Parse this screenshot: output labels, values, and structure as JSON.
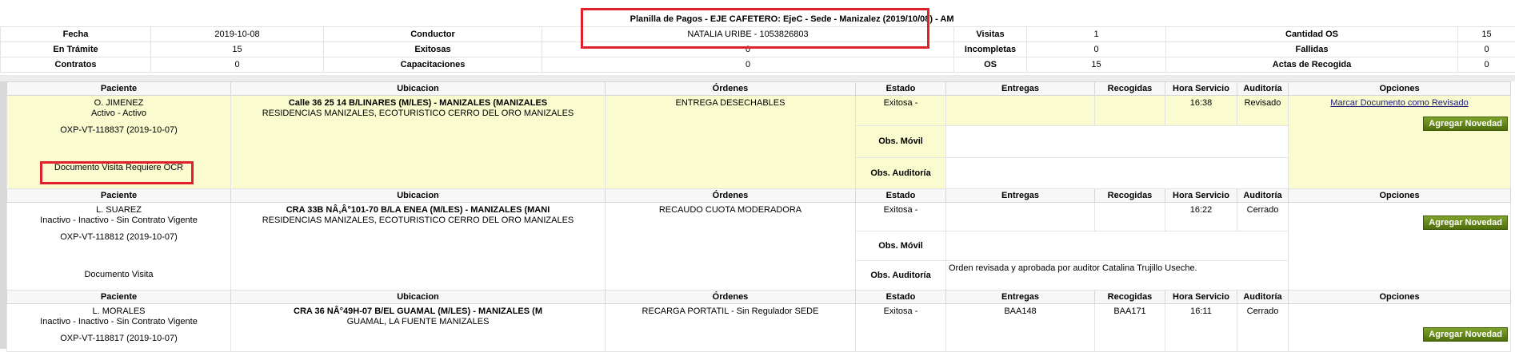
{
  "title": "Planilla de Pagos - EJE CAFETERO: EjeC - Sede - Manizalez (2019/10/08) - AM",
  "summary": {
    "row1": [
      {
        "label": "Fecha",
        "value": "2019-10-08"
      },
      {
        "label": "Conductor",
        "value": "NATALIA URIBE - 1053826803"
      },
      {
        "label": "Visitas",
        "value": "1"
      },
      {
        "label": "Cantidad OS",
        "value": "15"
      }
    ],
    "row2": [
      {
        "label": "En Trámite",
        "value": "15"
      },
      {
        "label": "Exitosas",
        "value": "0"
      },
      {
        "label": "Incompletas",
        "value": "0"
      },
      {
        "label": "Fallidas",
        "value": "0"
      }
    ],
    "row3": [
      {
        "label": "Contratos",
        "value": "0"
      },
      {
        "label": "Capacitaciones",
        "value": "0"
      },
      {
        "label": "OS",
        "value": "15"
      },
      {
        "label": "Actas de Recogida",
        "value": "0"
      }
    ]
  },
  "columns": [
    "Paciente",
    "Ubicacion",
    "Órdenes",
    "Estado",
    "Entregas",
    "Recogidas",
    "Hora Servicio",
    "Auditoría",
    "Opciones"
  ],
  "obs_movil_label": "Obs. Móvil",
  "obs_auditoria_label": "Obs. Auditoría",
  "add_novelty_label": "Agregar Novedad",
  "visits": [
    {
      "name": "O. JIMENEZ",
      "status": "Activo - Activo",
      "code": "OXP-VT-118837 (2019-10-07)",
      "docs": "Documento Visita   Requiere OCR",
      "address": "Calle 36 25 14 B/LINARES (M/LES) - MANIZALES (MANIZALES",
      "location": "RESIDENCIAS MANIZALES, ECOTURISTICO CERRO DEL ORO MANIZALES",
      "orders": "ENTREGA DESECHABLES",
      "state": "Exitosa -",
      "deliveries": "",
      "pickups": "",
      "time": "16:38",
      "audit": "Revisado",
      "option_link": "Marcar Documento como Revisado",
      "obs_movil": "",
      "obs_auditoria": ""
    },
    {
      "name": "L. SUAREZ",
      "status": "Inactivo - Inactivo - Sin Contrato Vigente",
      "code": "OXP-VT-118812 (2019-10-07)",
      "docs": "Documento Visita",
      "address": "CRA 33B NÂ,Â°101-70 B/LA ENEA (M/LES) - MANIZALES (MANI",
      "location": "RESIDENCIAS MANIZALES, ECOTURISTICO CERRO DEL ORO MANIZALES",
      "orders": "RECAUDO CUOTA MODERADORA",
      "state": "Exitosa -",
      "deliveries": "",
      "pickups": "",
      "time": "16:22",
      "audit": "Cerrado",
      "option_link": "",
      "obs_movil": "",
      "obs_auditoria": "Orden revisada y aprobada por auditor Catalina Trujillo Useche."
    },
    {
      "name": "L. MORALES",
      "status": "Inactivo - Inactivo - Sin Contrato Vigente",
      "code": "OXP-VT-118817 (2019-10-07)",
      "address": "CRA 36 NÂ°49H-07 B/EL GUAMAL (M/LES) - MANIZALES (M",
      "location": "GUAMAL, LA FUENTE MANIZALES",
      "orders": "RECARGA PORTATIL - Sin Regulador SEDE",
      "state": "Exitosa -",
      "deliveries": "BAA148",
      "pickups": "BAA171",
      "time": "16:11",
      "audit": "Cerrado"
    }
  ]
}
